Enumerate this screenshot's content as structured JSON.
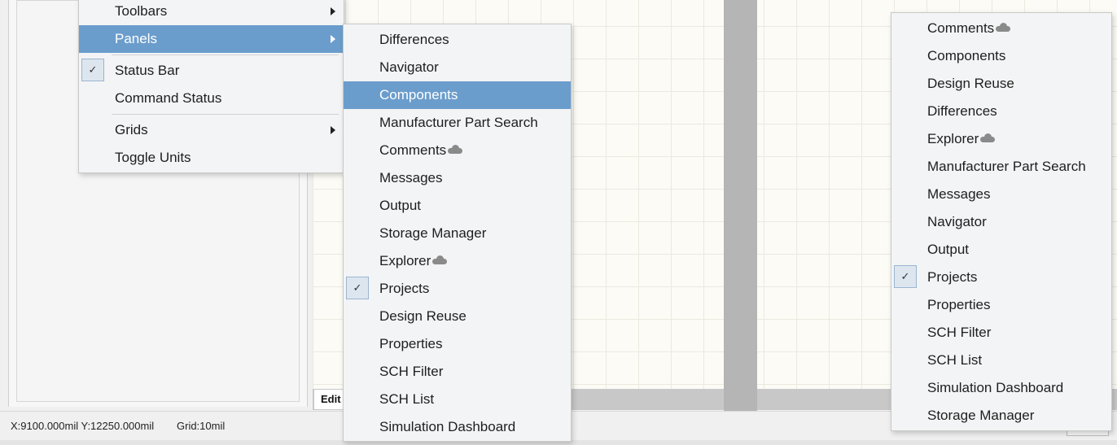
{
  "status_bar": {
    "coords": "X:9100.000mil Y:12250.000mil",
    "grid": "Grid:10mil"
  },
  "editor_tab": {
    "label": "Edit"
  },
  "view_menu": {
    "items": [
      {
        "label": "Toolbars",
        "submenu": true
      },
      {
        "label": "Panels",
        "submenu": true,
        "active": true
      },
      {
        "label": "Status Bar",
        "checked": true
      },
      {
        "label": "Command Status"
      },
      {
        "label": "Grids",
        "submenu": true
      },
      {
        "label": "Toggle Units"
      }
    ]
  },
  "panels_submenu": {
    "items": [
      {
        "label": "Differences"
      },
      {
        "label": "Navigator"
      },
      {
        "label": "Components",
        "active": true
      },
      {
        "label": "Manufacturer Part Search"
      },
      {
        "label": "Comments",
        "cloud": true
      },
      {
        "label": "Messages"
      },
      {
        "label": "Output"
      },
      {
        "label": "Storage Manager"
      },
      {
        "label": "Explorer",
        "cloud": true
      },
      {
        "label": "Projects",
        "checked": true
      },
      {
        "label": "Design Reuse"
      },
      {
        "label": "Properties"
      },
      {
        "label": "SCH Filter"
      },
      {
        "label": "SCH List"
      },
      {
        "label": "Simulation Dashboard"
      }
    ]
  },
  "panels_menu_sorted": {
    "items": [
      {
        "label": "Comments",
        "cloud": true
      },
      {
        "label": "Components"
      },
      {
        "label": "Design Reuse"
      },
      {
        "label": "Differences"
      },
      {
        "label": "Explorer",
        "cloud": true
      },
      {
        "label": "Manufacturer Part Search"
      },
      {
        "label": "Messages"
      },
      {
        "label": "Navigator"
      },
      {
        "label": "Output"
      },
      {
        "label": "Projects",
        "checked": true
      },
      {
        "label": "Properties"
      },
      {
        "label": "SCH Filter"
      },
      {
        "label": "SCH List"
      },
      {
        "label": "Simulation Dashboard"
      },
      {
        "label": "Storage Manager"
      }
    ]
  },
  "colors": {
    "highlight": "#6b9dcc",
    "menu_bg": "#f3f4f5",
    "canvas_bg": "#fcfbf5"
  },
  "icons": {
    "check": "check-icon",
    "submenu_arrow": "chevron-right-icon",
    "cloud": "cloud-icon"
  }
}
